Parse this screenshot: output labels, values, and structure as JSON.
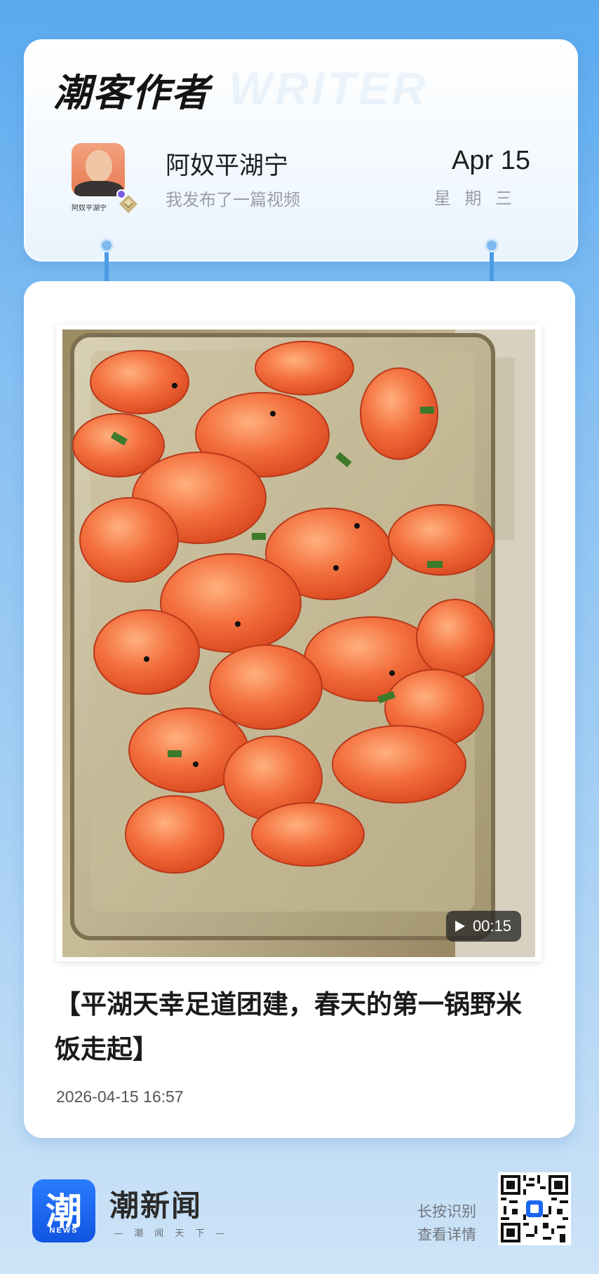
{
  "header": {
    "brand_title": "潮客作者",
    "brand_ghost": "WRITER",
    "author": {
      "name": "阿奴平湖宁",
      "avatar_caption": "阿奴平湖宁",
      "subtitle": "我发布了一篇视频"
    },
    "date": {
      "month_day": "Apr 15",
      "weekday": "星 期 三"
    }
  },
  "post": {
    "video_duration": "00:15",
    "title": "【平湖天幸足道团建，春天的第一锅野米饭走起】",
    "published_at": "2026-04-15 16:57"
  },
  "footer": {
    "logo_glyph": "潮",
    "logo_caption": "NEWS",
    "brand_name": "潮新闻",
    "slogan": "— 潮 闻 天 下 —",
    "qr_hint_line1": "长按识别",
    "qr_hint_line2": "查看详情"
  },
  "colors": {
    "accent": "#4d9ae6",
    "logo_blue": "#1a66f0",
    "background_top": "#5aa9ef",
    "background_bottom": "#cde3f7"
  }
}
